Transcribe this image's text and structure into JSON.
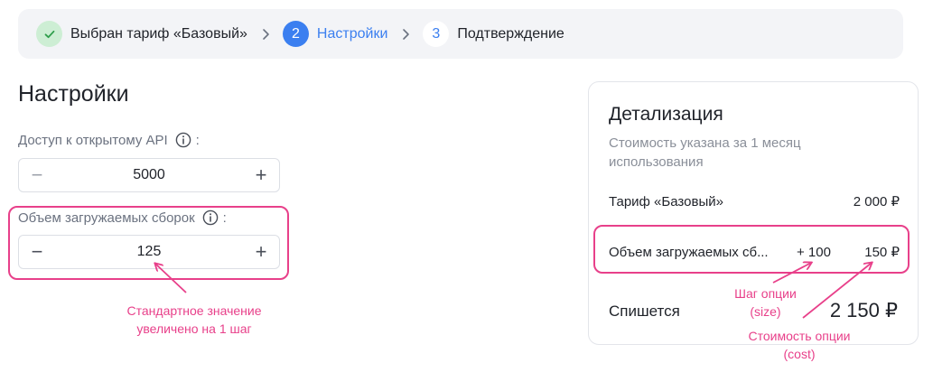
{
  "stepper": {
    "steps": [
      {
        "number": "✓",
        "label": "Выбран тариф «Базовый»",
        "state": "done"
      },
      {
        "number": "2",
        "label": "Настройки",
        "state": "active"
      },
      {
        "number": "3",
        "label": "Подтверждение",
        "state": "pending"
      }
    ]
  },
  "settings": {
    "title": "Настройки",
    "api_field": {
      "label": "Доступ к открытому API",
      "colon": ":",
      "value": "5000",
      "minus": "−",
      "plus": "+"
    },
    "builds_field": {
      "label": "Объем загружаемых сборок",
      "colon": ":",
      "value": "125",
      "minus": "−",
      "plus": "+"
    }
  },
  "annotations": {
    "default_value": "Стандартное значение увеличено на 1 шаг",
    "option_step": "Шаг опции (size)",
    "option_cost": "Стоимость опции (cost)"
  },
  "details": {
    "title": "Детализация",
    "subtitle": "Стоимость указана за 1 месяц использования",
    "tariff_row": {
      "name": "Тариф «Базовый»",
      "price": "2 000 ₽"
    },
    "option_row": {
      "name": "Объем загружаемых сб...",
      "step": "+ 100",
      "price": "150 ₽"
    },
    "total_label": "Спишется",
    "total_value": "2 150 ₽"
  },
  "colors": {
    "accent": "#3b7ff0",
    "annotation": "#e8408a",
    "done": "#2f9e4b"
  }
}
